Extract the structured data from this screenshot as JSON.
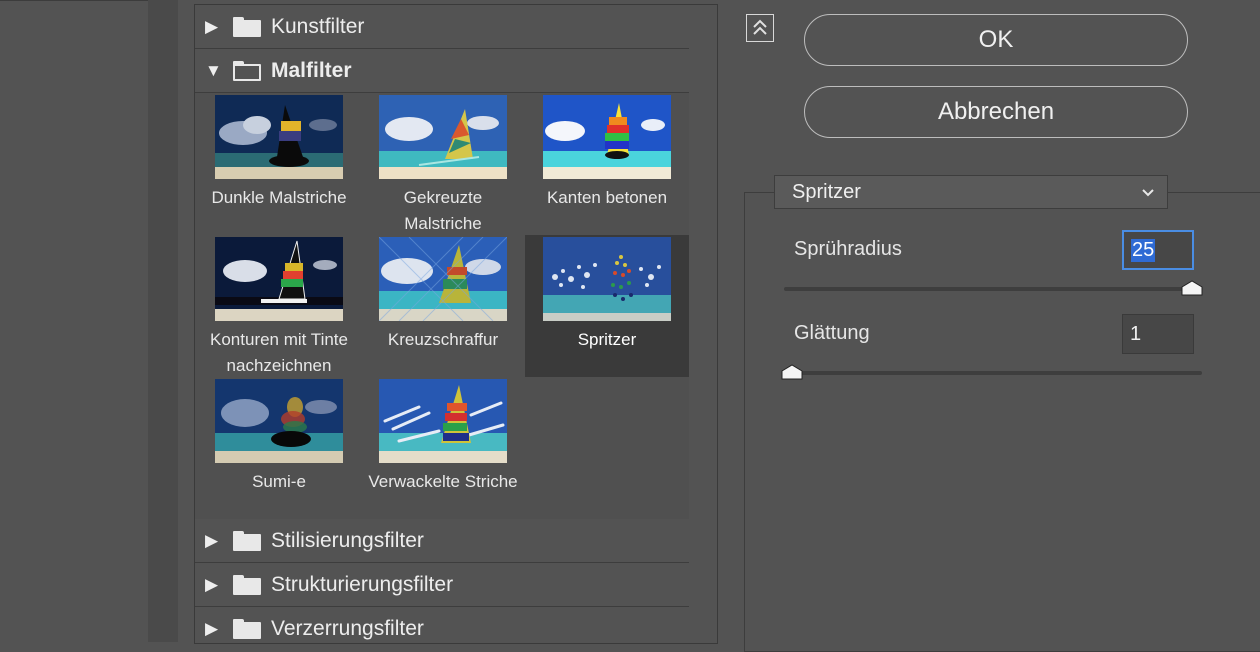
{
  "categories_top": [
    {
      "label": "Kunstfilter",
      "expanded": false
    },
    {
      "label": "Malfilter",
      "expanded": true
    }
  ],
  "categories_bottom": [
    {
      "label": "Stilisierungsfilter",
      "expanded": false
    },
    {
      "label": "Strukturierungsfilter",
      "expanded": false
    },
    {
      "label": "Verzerrungsfilter",
      "expanded": false
    }
  ],
  "filters": [
    {
      "line1": "Dunkle Malstriche",
      "line2": ""
    },
    {
      "line1": "Gekreuzte",
      "line2": "Malstriche"
    },
    {
      "line1": "Kanten betonen",
      "line2": ""
    },
    {
      "line1": "Konturen mit Tinte",
      "line2": "nachzeichnen"
    },
    {
      "line1": "Kreuzschraffur",
      "line2": ""
    },
    {
      "line1": "Spritzer",
      "line2": "",
      "selected": true
    },
    {
      "line1": "Sumi-e",
      "line2": ""
    },
    {
      "line1": "Verwackelte Striche",
      "line2": ""
    }
  ],
  "buttons": {
    "ok": "OK",
    "cancel": "Abbrechen"
  },
  "filter_select": {
    "selected": "Spritzer"
  },
  "params": {
    "spruehradius": {
      "label": "Sprühradius",
      "value": "25",
      "fraction": 1.0
    },
    "glaettung": {
      "label": "Glättung",
      "value": "1",
      "fraction": 0.0
    }
  },
  "colors": {
    "background": "#535353",
    "selection": "#2f6bd4",
    "focus_ring": "#4a8de3"
  }
}
